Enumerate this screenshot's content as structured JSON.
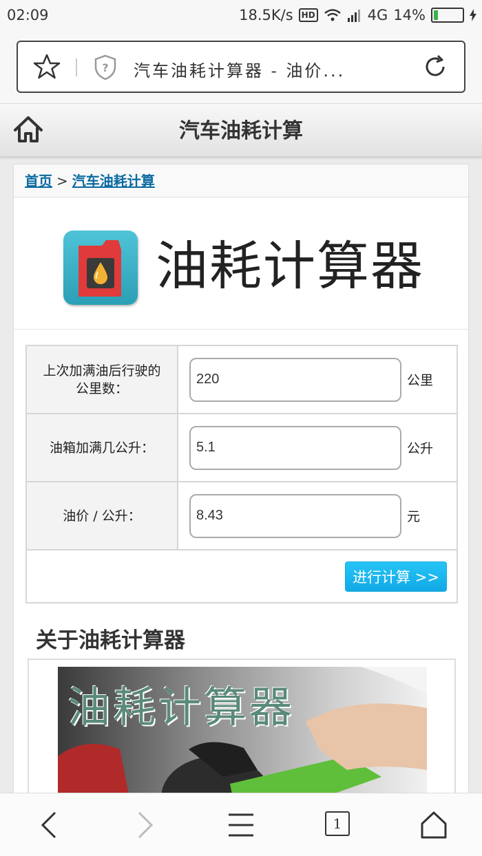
{
  "status_bar": {
    "time": "02:09",
    "speed": "18.5K/s",
    "hd": "HD",
    "network": "4G",
    "battery": "14%"
  },
  "browser": {
    "url_title": "汽车油耗计算器 - 油价...",
    "icons": [
      "star-icon",
      "shield-question-icon",
      "reload-icon"
    ]
  },
  "header": {
    "title": "汽车油耗计算"
  },
  "breadcrumb": {
    "home": "首页",
    "separator": ">",
    "current": "汽车油耗计算"
  },
  "hero": {
    "title": "油耗计算器"
  },
  "form": {
    "rows": [
      {
        "label": "上次加满油后行驶的公里数：",
        "value": "220",
        "unit": "公里"
      },
      {
        "label": "油箱加满几公升：",
        "value": "5.1",
        "unit": "公升"
      },
      {
        "label": "油价 / 公升：",
        "value": "8.43",
        "unit": "元"
      }
    ],
    "submit_label": "进行计算 >>"
  },
  "about": {
    "heading": "关于油耗计算器",
    "image_caption": "油耗计算器"
  },
  "bottom_nav": {
    "tab_count": "1"
  },
  "colors": {
    "accent": "#1eb6ee",
    "link": "#0b6aa2"
  }
}
